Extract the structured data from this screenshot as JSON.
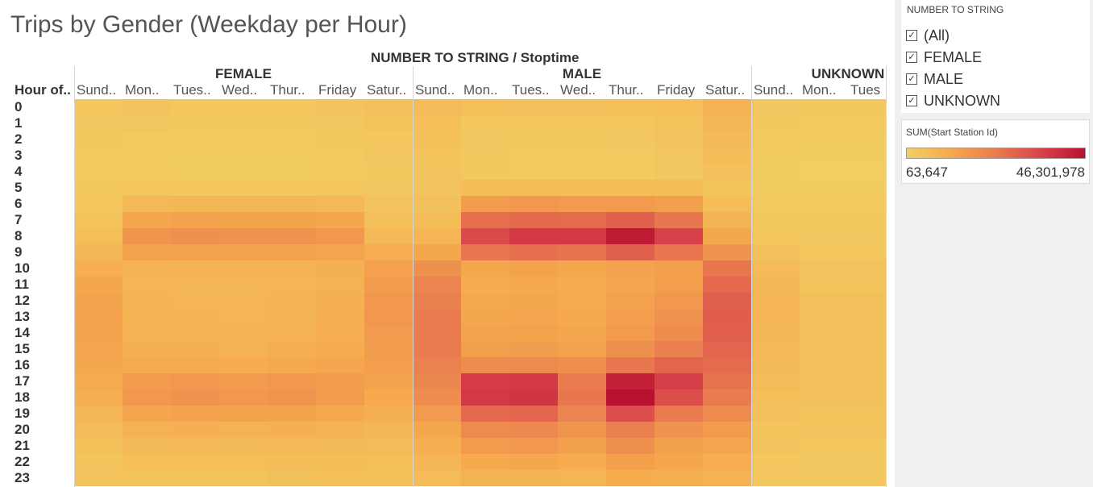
{
  "title": "Trips by Gender (Weekday per Hour)",
  "column_header": "NUMBER TO STRING / Stoptime",
  "row_header": "Hour of..",
  "filter": {
    "title": "NUMBER TO STRING",
    "items": [
      {
        "label": "(All)",
        "checked": true
      },
      {
        "label": "FEMALE",
        "checked": true
      },
      {
        "label": "MALE",
        "checked": true
      },
      {
        "label": "UNKNOWN",
        "checked": true
      }
    ]
  },
  "legend": {
    "title": "SUM(Start Station Id)",
    "min_label": "63,647",
    "max_label": "46,301,978",
    "min": 63647,
    "max": 46301978,
    "colors": [
      "#f2cf63",
      "#f6a94d",
      "#e97b4f",
      "#d9434a",
      "#b7112f"
    ]
  },
  "chart_data": {
    "type": "heatmap",
    "title": "Trips by Gender (Weekday per Hour)",
    "genders": [
      {
        "label": "FEMALE",
        "days": [
          "Sund..",
          "Mon..",
          "Tues..",
          "Wed..",
          "Thur..",
          "Friday",
          "Satur.."
        ]
      },
      {
        "label": "MALE",
        "days": [
          "Sund..",
          "Mon..",
          "Tues..",
          "Wed..",
          "Thur..",
          "Friday",
          "Satur.."
        ]
      },
      {
        "label": "UNKNOWN",
        "days": [
          "Sund..",
          "Mon..",
          "Tues"
        ]
      }
    ],
    "hours": [
      "0",
      "1",
      "2",
      "3",
      "4",
      "5",
      "6",
      "7",
      "8",
      "9",
      "10",
      "11",
      "12",
      "13",
      "14",
      "15",
      "16",
      "17",
      "18",
      "19",
      "20",
      "21",
      "22",
      "23"
    ],
    "scale": {
      "min": 63647,
      "max": 46301978
    },
    "values": {
      "FEMALE": [
        [
          0.06,
          0.07,
          0.06,
          0.06,
          0.06,
          0.07,
          0.09
        ],
        [
          0.05,
          0.05,
          0.04,
          0.04,
          0.04,
          0.05,
          0.08
        ],
        [
          0.04,
          0.03,
          0.03,
          0.03,
          0.03,
          0.04,
          0.06
        ],
        [
          0.03,
          0.02,
          0.02,
          0.02,
          0.02,
          0.03,
          0.05
        ],
        [
          0.03,
          0.03,
          0.02,
          0.02,
          0.02,
          0.03,
          0.04
        ],
        [
          0.04,
          0.06,
          0.06,
          0.06,
          0.06,
          0.06,
          0.05
        ],
        [
          0.06,
          0.15,
          0.16,
          0.16,
          0.16,
          0.15,
          0.07
        ],
        [
          0.08,
          0.27,
          0.29,
          0.28,
          0.28,
          0.26,
          0.1
        ],
        [
          0.11,
          0.36,
          0.38,
          0.37,
          0.37,
          0.34,
          0.15
        ],
        [
          0.16,
          0.28,
          0.29,
          0.29,
          0.29,
          0.27,
          0.22
        ],
        [
          0.22,
          0.19,
          0.18,
          0.18,
          0.19,
          0.2,
          0.29
        ],
        [
          0.26,
          0.17,
          0.16,
          0.16,
          0.17,
          0.19,
          0.32
        ],
        [
          0.28,
          0.18,
          0.17,
          0.17,
          0.18,
          0.2,
          0.34
        ],
        [
          0.29,
          0.18,
          0.18,
          0.17,
          0.18,
          0.21,
          0.34
        ],
        [
          0.28,
          0.19,
          0.18,
          0.18,
          0.19,
          0.22,
          0.33
        ],
        [
          0.27,
          0.2,
          0.2,
          0.19,
          0.21,
          0.24,
          0.32
        ],
        [
          0.26,
          0.24,
          0.24,
          0.23,
          0.25,
          0.27,
          0.31
        ],
        [
          0.24,
          0.33,
          0.34,
          0.33,
          0.34,
          0.32,
          0.28
        ],
        [
          0.21,
          0.35,
          0.37,
          0.35,
          0.36,
          0.32,
          0.25
        ],
        [
          0.17,
          0.27,
          0.29,
          0.28,
          0.28,
          0.25,
          0.2
        ],
        [
          0.13,
          0.19,
          0.2,
          0.19,
          0.2,
          0.18,
          0.16
        ],
        [
          0.1,
          0.14,
          0.15,
          0.14,
          0.15,
          0.14,
          0.13
        ],
        [
          0.08,
          0.11,
          0.11,
          0.11,
          0.12,
          0.12,
          0.11
        ],
        [
          0.07,
          0.08,
          0.08,
          0.08,
          0.09,
          0.1,
          0.1
        ]
      ],
      "MALE": [
        [
          0.13,
          0.1,
          0.09,
          0.09,
          0.1,
          0.11,
          0.19
        ],
        [
          0.11,
          0.06,
          0.06,
          0.06,
          0.06,
          0.08,
          0.16
        ],
        [
          0.1,
          0.05,
          0.04,
          0.04,
          0.05,
          0.07,
          0.14
        ],
        [
          0.08,
          0.04,
          0.03,
          0.03,
          0.03,
          0.05,
          0.12
        ],
        [
          0.07,
          0.04,
          0.03,
          0.03,
          0.03,
          0.05,
          0.09
        ],
        [
          0.07,
          0.12,
          0.12,
          0.12,
          0.12,
          0.12,
          0.08
        ],
        [
          0.09,
          0.32,
          0.34,
          0.33,
          0.33,
          0.3,
          0.12
        ],
        [
          0.12,
          0.55,
          0.58,
          0.57,
          0.62,
          0.52,
          0.18
        ],
        [
          0.17,
          0.72,
          0.8,
          0.8,
          0.95,
          0.76,
          0.26
        ],
        [
          0.26,
          0.52,
          0.55,
          0.54,
          0.62,
          0.52,
          0.37
        ],
        [
          0.38,
          0.26,
          0.28,
          0.26,
          0.29,
          0.3,
          0.52
        ],
        [
          0.45,
          0.23,
          0.25,
          0.23,
          0.27,
          0.31,
          0.58
        ],
        [
          0.48,
          0.25,
          0.26,
          0.24,
          0.29,
          0.34,
          0.62
        ],
        [
          0.5,
          0.26,
          0.27,
          0.25,
          0.31,
          0.37,
          0.63
        ],
        [
          0.5,
          0.28,
          0.28,
          0.26,
          0.33,
          0.41,
          0.62
        ],
        [
          0.49,
          0.31,
          0.32,
          0.29,
          0.38,
          0.48,
          0.6
        ],
        [
          0.47,
          0.41,
          0.42,
          0.39,
          0.52,
          0.6,
          0.57
        ],
        [
          0.44,
          0.79,
          0.8,
          0.5,
          0.92,
          0.77,
          0.54
        ],
        [
          0.4,
          0.8,
          0.82,
          0.52,
          1.0,
          0.7,
          0.5
        ],
        [
          0.33,
          0.58,
          0.6,
          0.45,
          0.7,
          0.5,
          0.42
        ],
        [
          0.26,
          0.42,
          0.43,
          0.36,
          0.48,
          0.37,
          0.33
        ],
        [
          0.21,
          0.33,
          0.34,
          0.3,
          0.38,
          0.3,
          0.27
        ],
        [
          0.16,
          0.25,
          0.26,
          0.23,
          0.3,
          0.26,
          0.22
        ],
        [
          0.13,
          0.18,
          0.18,
          0.17,
          0.23,
          0.21,
          0.19
        ]
      ],
      "UNKNOWN": [
        [
          0.05,
          0.04,
          0.04
        ],
        [
          0.04,
          0.03,
          0.03
        ],
        [
          0.03,
          0.02,
          0.02
        ],
        [
          0.02,
          0.02,
          0.02
        ],
        [
          0.02,
          0.01,
          0.01
        ],
        [
          0.02,
          0.02,
          0.02
        ],
        [
          0.03,
          0.03,
          0.03
        ],
        [
          0.04,
          0.04,
          0.04
        ],
        [
          0.06,
          0.05,
          0.05
        ],
        [
          0.09,
          0.06,
          0.06
        ],
        [
          0.13,
          0.07,
          0.07
        ],
        [
          0.16,
          0.08,
          0.08
        ],
        [
          0.17,
          0.09,
          0.09
        ],
        [
          0.17,
          0.09,
          0.09
        ],
        [
          0.16,
          0.09,
          0.09
        ],
        [
          0.15,
          0.09,
          0.09
        ],
        [
          0.14,
          0.09,
          0.09
        ],
        [
          0.13,
          0.09,
          0.09
        ],
        [
          0.11,
          0.09,
          0.09
        ],
        [
          0.09,
          0.08,
          0.08
        ],
        [
          0.08,
          0.07,
          0.07
        ],
        [
          0.07,
          0.06,
          0.06
        ],
        [
          0.06,
          0.05,
          0.05
        ],
        [
          0.05,
          0.05,
          0.05
        ]
      ]
    }
  }
}
